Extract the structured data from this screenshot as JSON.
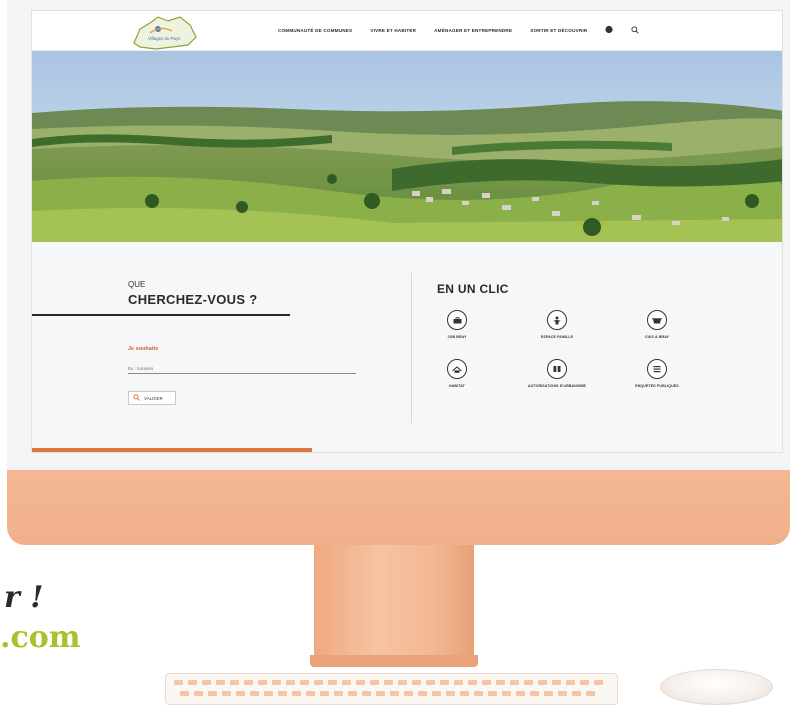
{
  "header": {
    "logo_text": "Villages du Pays",
    "nav": [
      "COMMUNAUTÉ DE COMMUNES",
      "VIVRE ET HABITER",
      "AMÉNAGER ET ENTREPRENDRE",
      "SORTIR ET DÉCOUVRIR"
    ],
    "account_icon": "user-icon",
    "search_icon": "search-icon"
  },
  "search": {
    "que": "QUE",
    "title": "CHERCHEZ-VOUS ?",
    "wish_label": "Je souhaite",
    "placeholder": "Ex : horaires",
    "validate_label": "VALIDER",
    "validate_icon": "search-icon"
  },
  "quick_links": {
    "title": "EN UN CLIC",
    "items": [
      {
        "label": "JOB BRAY",
        "icon": "briefcase-icon"
      },
      {
        "label": "ESPACE FAMILLE",
        "icon": "family-icon"
      },
      {
        "label": "CUIS & BRAY",
        "icon": "cooking-pot-icon"
      },
      {
        "label": "HABITAT",
        "icon": "house-icon"
      },
      {
        "label": "AUTORISATIONS D'URBANISME",
        "icon": "document-icon"
      },
      {
        "label": "ENQUÊTES PUBLIQUES",
        "icon": "list-icon"
      }
    ]
  },
  "promo": {
    "line1": "r !",
    "line2": ".com"
  },
  "colors": {
    "accent": "#d97642",
    "accent_text": "#d4622a",
    "promo_green": "#a5c32c",
    "imac_body": "#f5bd99"
  }
}
